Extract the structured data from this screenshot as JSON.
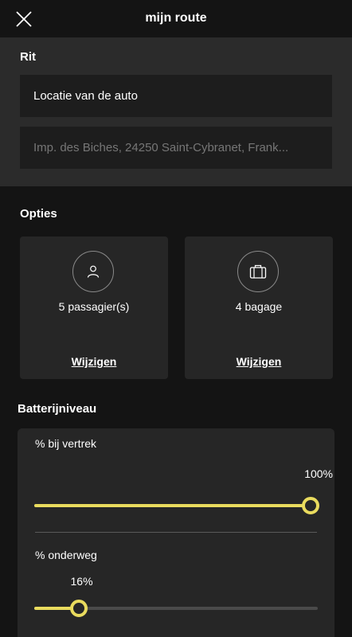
{
  "header": {
    "title": "mijn route"
  },
  "rit": {
    "label": "Rit",
    "location_field": "Locatie van de auto",
    "address_placeholder": "Imp. des Biches, 24250 Saint-Cybranet, Frank..."
  },
  "options": {
    "label": "Opties",
    "passengers": {
      "icon": "person-icon",
      "text": "5 passagier(s)",
      "link": "Wijzigen"
    },
    "luggage": {
      "icon": "suitcase-icon",
      "text": "4 bagage",
      "link": "Wijzigen"
    }
  },
  "battery": {
    "label": "Batterijniveau",
    "departure": {
      "label": "% bij vertrek",
      "value_text": "100%",
      "level": 1.0
    },
    "en_route": {
      "label": "% onderweg",
      "value_text": "16%",
      "level": 0.16
    }
  },
  "colors": {
    "accent": "#e9db5e",
    "background": "#141414",
    "card": "#262626",
    "section": "#2b2b2b"
  }
}
